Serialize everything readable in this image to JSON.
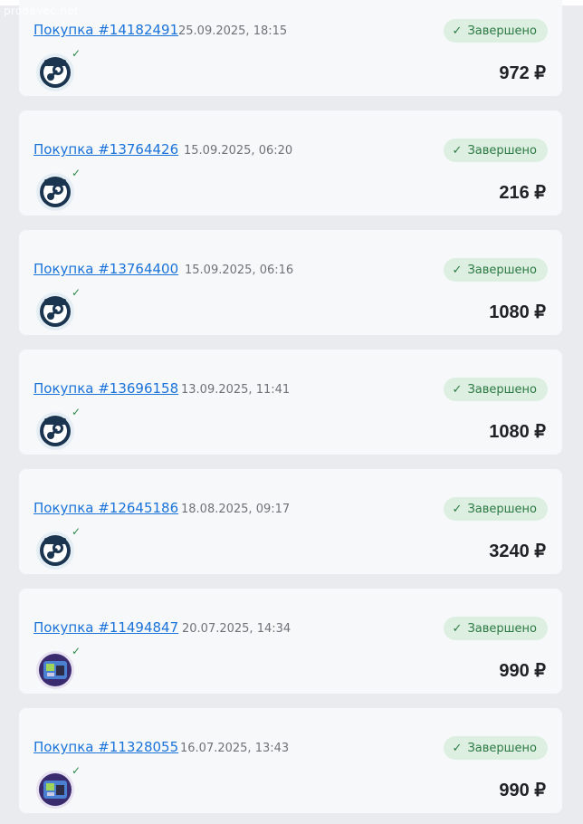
{
  "watermark": "prodavec.net",
  "status_label": "Завершено",
  "purchases": [
    {
      "link": "Покупка #14182491",
      "datetime": "25.09.2025, 18:15",
      "price": "972 ₽",
      "thumb": "steam-icon"
    },
    {
      "link": "Покупка #13764426",
      "datetime": "15.09.2025, 06:20",
      "price": "216 ₽",
      "thumb": "steam-icon"
    },
    {
      "link": "Покупка #13764400",
      "datetime": "15.09.2025, 06:16",
      "price": "1080 ₽",
      "thumb": "steam-icon"
    },
    {
      "link": "Покупка #13696158",
      "datetime": "13.09.2025, 11:41",
      "price": "1080 ₽",
      "thumb": "steam-icon"
    },
    {
      "link": "Покупка #12645186",
      "datetime": "18.08.2025, 09:17",
      "price": "3240 ₽",
      "thumb": "steam-icon"
    },
    {
      "link": "Покупка #11494847",
      "datetime": "20.07.2025, 14:34",
      "price": "990 ₽",
      "thumb": "game-card-icon"
    },
    {
      "link": "Покупка #11328055",
      "datetime": "16.07.2025, 13:43",
      "price": "990 ₽",
      "thumb": "game-card-icon"
    }
  ],
  "colors": {
    "link": "#1a73d9",
    "status_bg": "#dcefe1",
    "status_text": "#2d7a44",
    "card_bg": "#f7f8fa",
    "page_bg": "#e9ebee"
  }
}
